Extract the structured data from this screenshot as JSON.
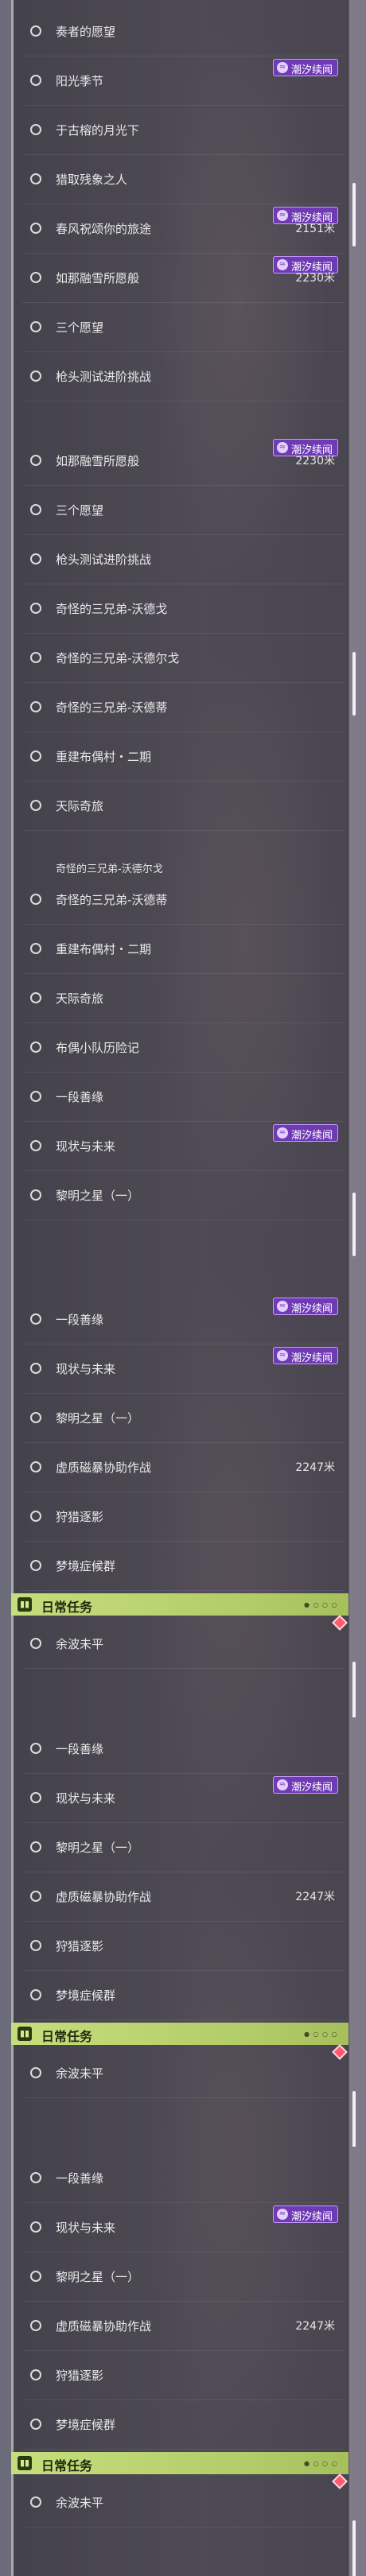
{
  "badge": "潮汐续闻",
  "badge_icon": "tide-icon",
  "daily_title": "日常任务",
  "daily_icon": "book-icon",
  "frames": [
    {
      "top_fragment": "",
      "rows": [
        {
          "label": "奏者的愿望",
          "tag": false,
          "dist": ""
        },
        {
          "label": "阳光季节",
          "tag": true,
          "dist": ""
        },
        {
          "label": "于古榕的月光下",
          "tag": false,
          "dist": ""
        },
        {
          "label": "猎取残象之人",
          "tag": false,
          "dist": ""
        },
        {
          "label": "春风祝颂你的旅途",
          "tag": true,
          "dist": "2151米"
        },
        {
          "label": "如那融雪所愿般",
          "tag": true,
          "dist": "2230米"
        },
        {
          "label": "三个愿望",
          "tag": false,
          "dist": ""
        },
        {
          "label": "枪头测试进阶挑战",
          "tag": false,
          "dist": ""
        }
      ]
    },
    {
      "top_fragment": "",
      "rows": [
        {
          "label": "如那融雪所愿般",
          "tag": true,
          "dist": "2230米"
        },
        {
          "label": "三个愿望",
          "tag": false,
          "dist": ""
        },
        {
          "label": "枪头测试进阶挑战",
          "tag": false,
          "dist": ""
        },
        {
          "label": "奇怪的三兄弟-沃德戈",
          "tag": false,
          "dist": ""
        },
        {
          "label": "奇怪的三兄弟-沃德尔戈",
          "tag": false,
          "dist": ""
        },
        {
          "label": "奇怪的三兄弟-沃德蒂",
          "tag": false,
          "dist": ""
        },
        {
          "label": "重建布偶村・二期",
          "tag": false,
          "dist": ""
        },
        {
          "label": "天际奇旅",
          "tag": false,
          "dist": ""
        }
      ]
    },
    {
      "top_fragment": "奇怪的三兄弟-沃德尔戈",
      "rows": [
        {
          "label": "奇怪的三兄弟-沃德蒂",
          "tag": false,
          "dist": ""
        },
        {
          "label": "重建布偶村・二期",
          "tag": false,
          "dist": ""
        },
        {
          "label": "天际奇旅",
          "tag": false,
          "dist": ""
        },
        {
          "label": "布偶小队历险记",
          "tag": false,
          "dist": ""
        },
        {
          "label": "一段善缘",
          "tag": false,
          "dist": ""
        },
        {
          "label": "现状与未来",
          "tag": true,
          "dist": ""
        },
        {
          "label": "黎明之星（一）",
          "tag": false,
          "dist": ""
        }
      ]
    },
    {
      "top_fragment": "",
      "rows": [
        {
          "label": "一段善缘",
          "tag": true,
          "dist": ""
        },
        {
          "label": "现状与未来",
          "tag": true,
          "dist": ""
        },
        {
          "label": "黎明之星（一）",
          "tag": false,
          "dist": ""
        },
        {
          "label": "虚质磁暴协助作战",
          "tag": false,
          "dist": "2247米"
        },
        {
          "label": "狩猎逐影",
          "tag": false,
          "dist": ""
        },
        {
          "label": "梦境症候群",
          "tag": false,
          "dist": ""
        }
      ],
      "daily": {
        "label": "余波未平"
      }
    },
    {
      "top_fragment": "",
      "rows": [
        {
          "label": "一段善缘",
          "tag": false,
          "dist": ""
        },
        {
          "label": "现状与未来",
          "tag": true,
          "dist": ""
        },
        {
          "label": "黎明之星（一）",
          "tag": false,
          "dist": ""
        },
        {
          "label": "虚质磁暴协助作战",
          "tag": false,
          "dist": "2247米"
        },
        {
          "label": "狩猎逐影",
          "tag": false,
          "dist": ""
        },
        {
          "label": "梦境症候群",
          "tag": false,
          "dist": ""
        }
      ],
      "daily": {
        "label": "余波未平"
      }
    },
    {
      "top_fragment": "",
      "rows": [
        {
          "label": "一段善缘",
          "tag": false,
          "dist": ""
        },
        {
          "label": "现状与未来",
          "tag": true,
          "dist": ""
        },
        {
          "label": "黎明之星（一）",
          "tag": false,
          "dist": ""
        },
        {
          "label": "虚质磁暴协助作战",
          "tag": false,
          "dist": "2247米"
        },
        {
          "label": "狩猎逐影",
          "tag": false,
          "dist": ""
        },
        {
          "label": "梦境症候群",
          "tag": false,
          "dist": ""
        }
      ],
      "daily": {
        "label": "余波未平"
      }
    }
  ]
}
